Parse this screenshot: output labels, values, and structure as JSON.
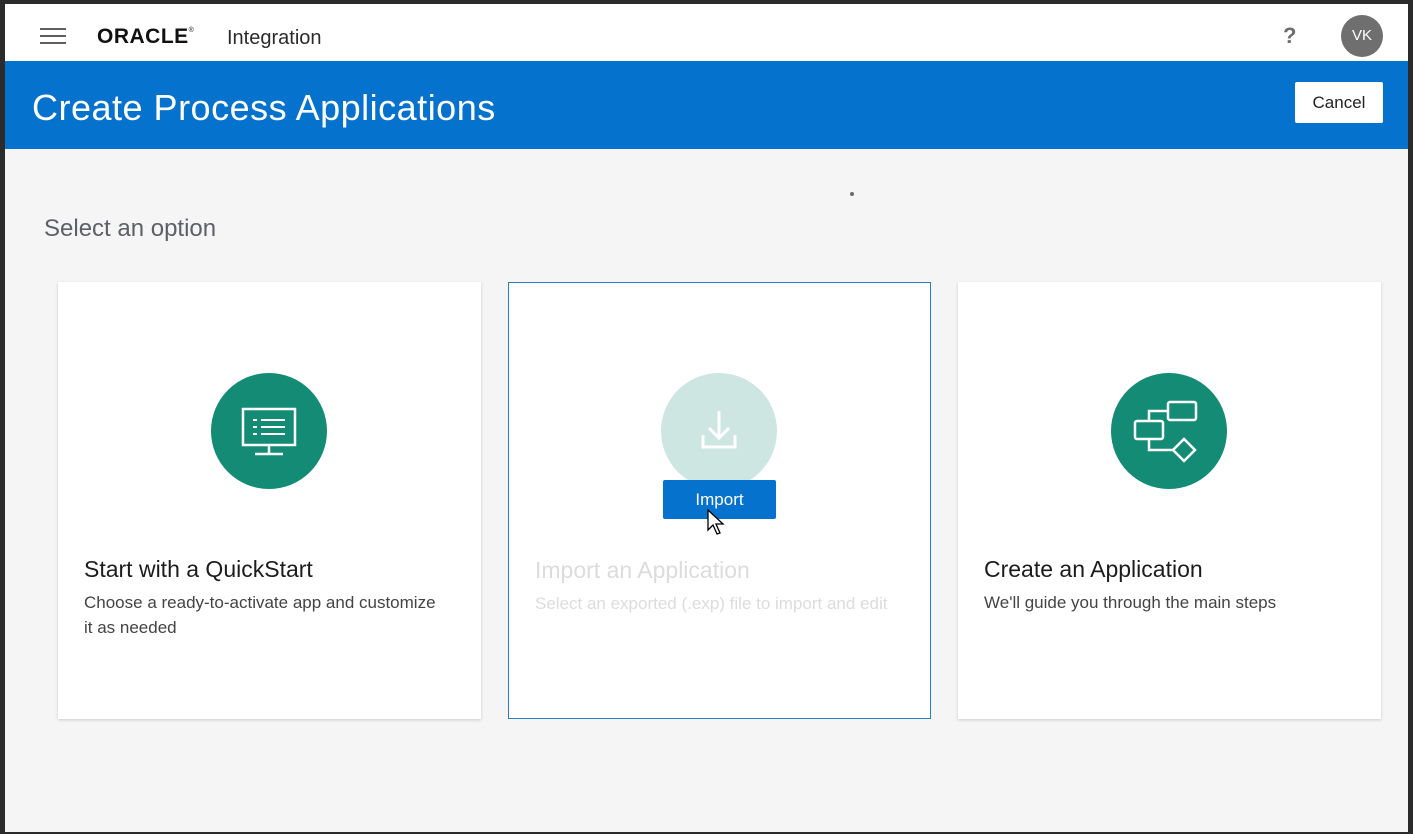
{
  "header": {
    "brand": "ORACLE",
    "product": "Integration",
    "help_label": "?",
    "avatar_initials": "VK"
  },
  "banner": {
    "title": "Create Process Applications",
    "cancel_label": "Cancel"
  },
  "main": {
    "subtitle": "Select an option",
    "cards": [
      {
        "title": "Start with a QuickStart",
        "description": "Choose a ready-to-activate app and customize it as needed",
        "icon": "monitor-icon"
      },
      {
        "title": "Import an Application",
        "description": "Select an exported (.exp) file to import and edit",
        "icon": "download-icon",
        "action_label": "Import"
      },
      {
        "title": "Create an Application",
        "description": "We'll guide you through the main steps",
        "icon": "process-flow-icon"
      }
    ]
  },
  "colors": {
    "brand_blue": "#0572ce",
    "icon_teal": "#138b75",
    "background": "#f5f5f5"
  }
}
